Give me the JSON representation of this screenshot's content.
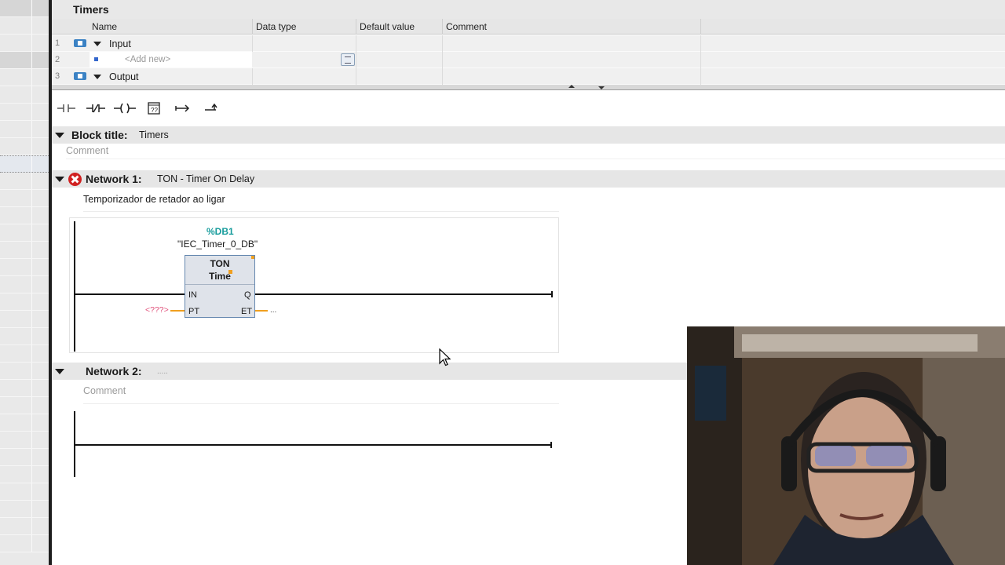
{
  "interface": {
    "title": "Timers",
    "columns": [
      "Name",
      "Data type",
      "Default value",
      "Comment"
    ],
    "rows": [
      {
        "num": "1",
        "label": "Input"
      },
      {
        "num": "2",
        "label": "<Add new>"
      },
      {
        "num": "3",
        "label": "Output"
      }
    ]
  },
  "toolbar": {
    "items": [
      "normally-open-contact",
      "normally-closed-contact",
      "output-coil",
      "empty-box",
      "open-branch",
      "close-branch"
    ]
  },
  "block": {
    "title_label": "Block title:",
    "title_value": "Timers",
    "comment_placeholder": "Comment"
  },
  "network1": {
    "label": "Network 1:",
    "title": "TON - Timer On Delay",
    "comment": "Temporizador de retador ao ligar",
    "status": "error",
    "instance_number": "%DB1",
    "instance_name": "\"IEC_Timer_0_DB\"",
    "block_name": "TON",
    "block_type": "Time",
    "pins": {
      "in": "IN",
      "pt": "PT",
      "q": "Q",
      "et": "ET"
    },
    "pt_value": "<???>",
    "et_value": "..."
  },
  "network2": {
    "label": "Network 2:",
    "title": ".....",
    "comment_placeholder": "Comment"
  },
  "colors": {
    "accent": "#179c9c",
    "error": "#d02020",
    "wire_param": "#f0a020",
    "missing_value": "#e0507a"
  }
}
